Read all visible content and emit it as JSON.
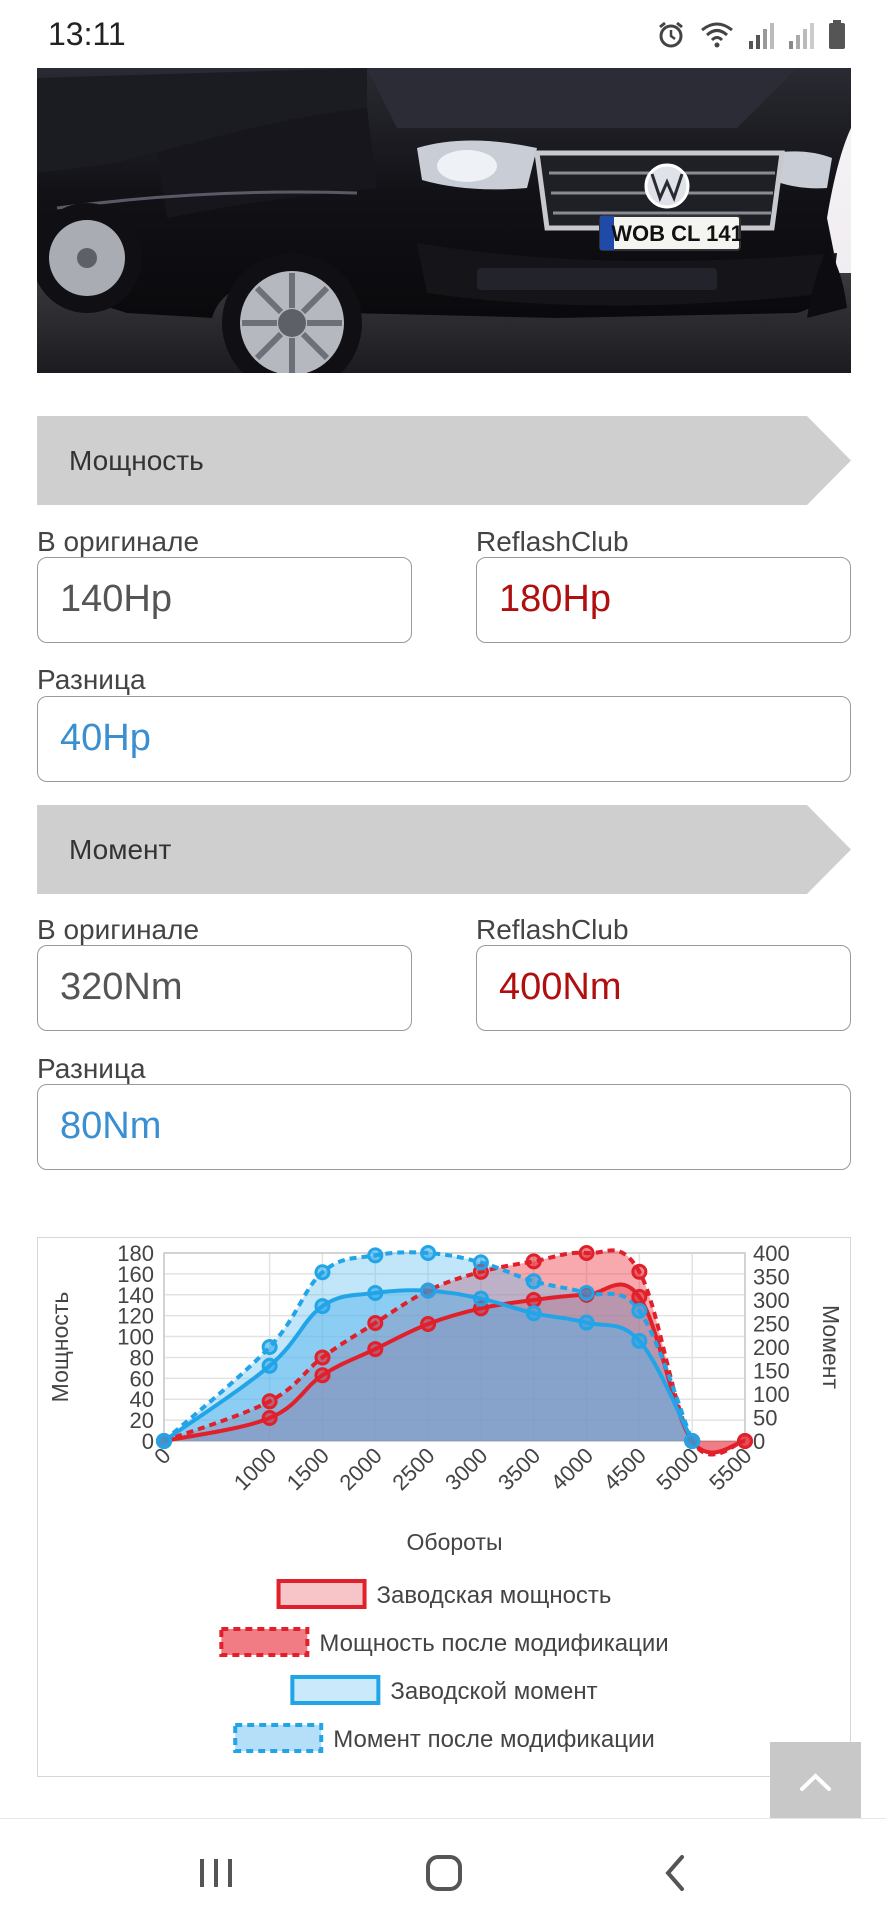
{
  "status": {
    "time": "13:11"
  },
  "power": {
    "title": "Мощность",
    "original_label": "В оригинале",
    "original_value": "140Hp",
    "tuned_label": "ReflashClub",
    "tuned_value": "180Hp",
    "diff_label": "Разница",
    "diff_value": "40Hp"
  },
  "torque": {
    "title": "Момент",
    "original_label": "В оригинале",
    "original_value": "320Nm",
    "tuned_label": "ReflashClub",
    "tuned_value": "400Nm",
    "diff_label": "Разница",
    "diff_value": "80Nm"
  },
  "car": {
    "plate": "WOB CL 141"
  },
  "chart_data": {
    "type": "area",
    "xlabel": "Обороты",
    "ylabel_left": "Мощность",
    "ylabel_right": "Момент",
    "x": [
      0,
      1000,
      1500,
      2000,
      2500,
      3000,
      3500,
      4000,
      4500,
      5000,
      5500
    ],
    "x_tick_labels": [
      "0",
      "1000",
      "1500",
      "2000",
      "2500",
      "3000",
      "3500",
      "4000",
      "4500",
      "5000",
      "5500"
    ],
    "ylim_left": [
      0,
      180
    ],
    "yticks_left": [
      0,
      20,
      40,
      60,
      80,
      100,
      120,
      140,
      160,
      180
    ],
    "ylim_right": [
      0,
      400
    ],
    "yticks_right": [
      0,
      50,
      100,
      150,
      200,
      250,
      300,
      350,
      400
    ],
    "grid": true,
    "legend_position": "bottom",
    "series": [
      {
        "name": "Заводская мощность",
        "axis": "left",
        "color": "#e0202a",
        "dashed": false,
        "values": [
          0,
          22,
          63,
          88,
          112,
          127,
          135,
          140,
          138,
          0,
          0
        ]
      },
      {
        "name": "Мощность после модификации",
        "axis": "left",
        "color": "#e0202a",
        "dashed": true,
        "values": [
          0,
          38,
          80,
          113,
          144,
          162,
          172,
          180,
          162,
          0,
          0
        ]
      },
      {
        "name": "Заводской момент",
        "axis": "right",
        "color": "#22a4e8",
        "dashed": false,
        "values": [
          0,
          160,
          287,
          315,
          320,
          303,
          272,
          252,
          213,
          0,
          null
        ]
      },
      {
        "name": "Момент после модификации",
        "axis": "right",
        "color": "#22a4e8",
        "dashed": true,
        "values": [
          0,
          200,
          359,
          395,
          400,
          380,
          340,
          315,
          277,
          0,
          null
        ]
      }
    ]
  }
}
